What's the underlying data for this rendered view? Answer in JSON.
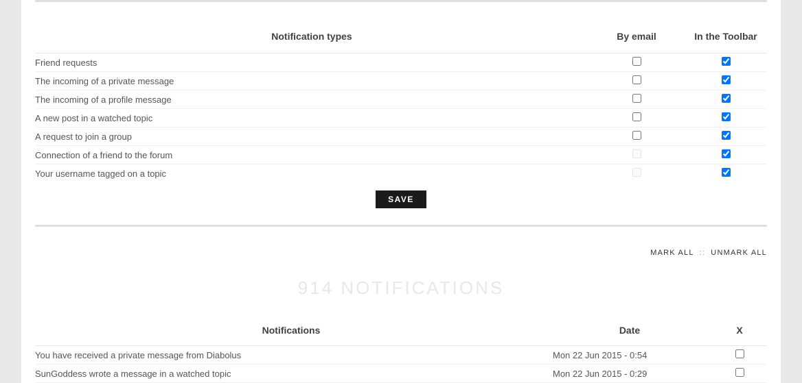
{
  "notif_types": {
    "header": {
      "types": "Notification types",
      "email": "By email",
      "toolbar": "In the Toolbar"
    },
    "rows": [
      {
        "label": "Friend requests",
        "email": false,
        "email_disabled": false,
        "toolbar": true
      },
      {
        "label": "The incoming of a private message",
        "email": false,
        "email_disabled": false,
        "toolbar": true
      },
      {
        "label": "The incoming of a profile message",
        "email": false,
        "email_disabled": false,
        "toolbar": true
      },
      {
        "label": "A new post in a watched topic",
        "email": false,
        "email_disabled": false,
        "toolbar": true
      },
      {
        "label": "A request to join a group",
        "email": false,
        "email_disabled": false,
        "toolbar": true
      },
      {
        "label": "Connection of a friend to the forum",
        "email": false,
        "email_disabled": true,
        "toolbar": true
      },
      {
        "label": "Your username tagged on a topic",
        "email": false,
        "email_disabled": true,
        "toolbar": true
      }
    ],
    "save_label": "SAVE"
  },
  "mark": {
    "mark_all": "MARK ALL",
    "sep": "::",
    "unmark_all": "UNMARK ALL"
  },
  "notif_list": {
    "heading": "914 NOTIFICATIONS",
    "header": {
      "notif": "Notifications",
      "date": "Date",
      "x": "X"
    },
    "rows": [
      {
        "parts": [
          {
            "text": "You have received a ",
            "link": false
          },
          {
            "text": "private message",
            "link": true
          },
          {
            "text": " from ",
            "link": false
          },
          {
            "text": "Diabolus",
            "link": true
          }
        ],
        "date": "Mon 22 Jun 2015 - 0:54",
        "checked": false
      },
      {
        "parts": [
          {
            "text": "SunGoddess",
            "link": true
          },
          {
            "text": " wrote a message ",
            "link": false
          },
          {
            "text": "in a watched topic",
            "link": true
          }
        ],
        "date": "Mon 22 Jun 2015 - 0:29",
        "checked": false
      }
    ]
  }
}
